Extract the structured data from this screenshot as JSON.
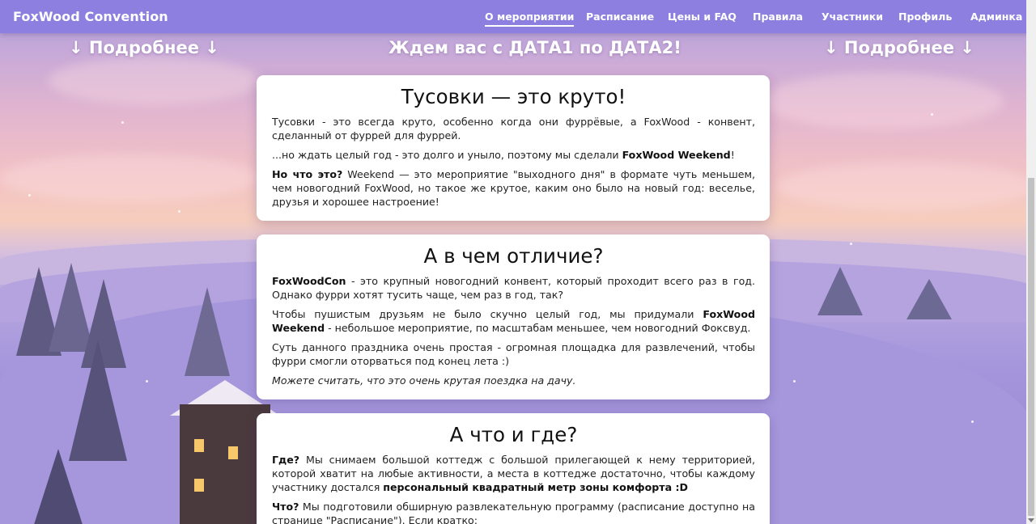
{
  "nav": {
    "brand": "FoxWood Convention",
    "items": [
      {
        "label": "О мероприятии",
        "active": true
      },
      {
        "label": "Расписание",
        "active": false
      },
      {
        "label": "Цены и FAQ",
        "active": false
      },
      {
        "label": "Правила",
        "active": false
      },
      {
        "label": "Участники",
        "active": false
      },
      {
        "label": "Профиль",
        "active": false
      },
      {
        "label": "Админка",
        "active": false
      }
    ]
  },
  "banner": {
    "left_link": "↓ Подробнее ↓",
    "center": "Ждем вас с ДАТА1 по ДАТА2!",
    "right_link": "↓ Подробнее ↓"
  },
  "cards": [
    {
      "title": "Тусовки — это круто!",
      "p1": "Тусовки - это всегда круто, особенно когда они фуррёвые, а FoxWood - конвент, сделанный от фуррей для фуррей.",
      "p2_pre": "...но ждать целый год - это долго и уныло, поэтому мы сделали ",
      "p2_bold": "FoxWood Weekend",
      "p2_post": "!",
      "p3_bold": "Но что это?",
      "p3_rest": " Weekend — это мероприятие \"выходного дня\" в формате чуть меньшем, чем новогодний FoxWood, но такое же крутое, каким оно было на новый год: веселье, друзья и хорошее настроение!"
    },
    {
      "title": "А в чем отличие?",
      "p1_bold": "FoxWoodCon",
      "p1_rest": " - это крупный новогодний конвент, который проходит всего раз в год. Однако фурри хотят тусить чаще, чем раз в год, так?",
      "p2_pre": "Чтобы пушистым друзьям не было скучно целый год, мы придумали ",
      "p2_bold": "FoxWood Weekend",
      "p2_post": " - небольшое мероприятие, по масштабам меньшее, чем новогодний Фоксвуд.",
      "p3": "Суть данного праздника очень простая - огромная площадка для развлечений, чтобы фурри смогли оторваться под конец лета :)",
      "p4_italic": "Можете считать, что это очень крутая поездка на дачу."
    },
    {
      "title": "А что и где?",
      "p1_bold": "Где?",
      "p1_rest": " Мы снимаем большой коттедж с большой прилегающей к нему территорией, которой хватит на любые активности, а места в коттедже достаточно, чтобы каждому участнику достался ",
      "p1_bold2": "персональный квадратный метр зоны комфорта :D",
      "p2_bold": "Что?",
      "p2_rest": " Мы подготовили обширную развлекательную программу (расписание доступно на странице \"Расписание\"). Если кратко:"
    }
  ],
  "colors": {
    "navbar": "#8d7fe0",
    "card_bg": "#ffffff"
  }
}
